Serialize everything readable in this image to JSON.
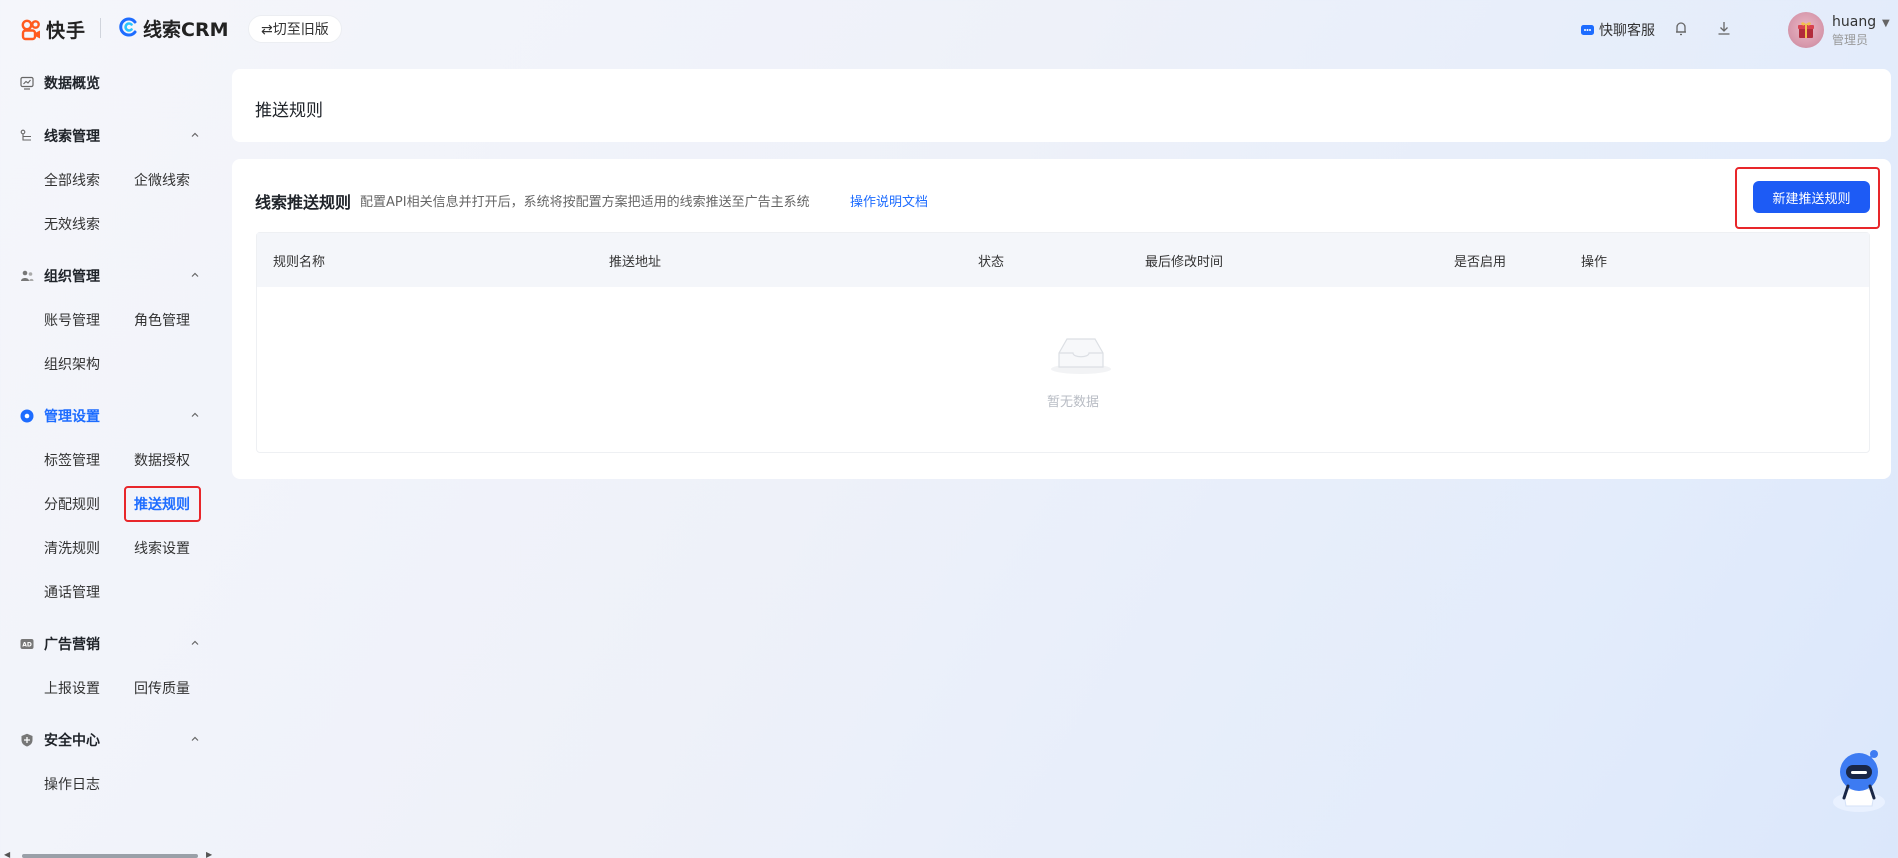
{
  "topbar": {
    "brand_name": "快手",
    "product_name": "线索CRM",
    "switch_label": "⇄切至旧版",
    "kefu_label": "快聊客服",
    "user_name": "huang",
    "user_role": "管理员"
  },
  "sidebar": {
    "data_overview": "数据概览",
    "groups": [
      {
        "label": "线索管理",
        "icon": "clue-icon",
        "items": [
          "全部线索",
          "企微线索",
          "无效线索"
        ]
      },
      {
        "label": "组织管理",
        "icon": "org-icon",
        "items": [
          "账号管理",
          "角色管理",
          "组织架构"
        ]
      },
      {
        "label": "管理设置",
        "icon": "settings-icon",
        "active": true,
        "items": [
          "标签管理",
          "数据授权",
          "分配规则",
          "推送规则",
          "清洗规则",
          "线索设置",
          "通话管理"
        ]
      },
      {
        "label": "广告营销",
        "icon": "ad-icon",
        "items": [
          "上报设置",
          "回传质量"
        ]
      },
      {
        "label": "安全中心",
        "icon": "shield-icon",
        "items": [
          "操作日志"
        ]
      }
    ],
    "active_item": "推送规则",
    "ad_badge": "AD"
  },
  "page": {
    "title": "推送规则",
    "section_title": "线索推送规则",
    "section_desc": "配置API相关信息并打开后，系统将按配置方案把适用的线索推送至广告主系统",
    "doc_link": "操作说明文档",
    "new_button": "新建推送规则"
  },
  "table": {
    "columns": [
      "规则名称",
      "推送地址",
      "状态",
      "最后修改时间",
      "是否启用",
      "操作"
    ],
    "rows": [],
    "empty_text": "暂无数据"
  },
  "colors": {
    "accent": "#1d6cff",
    "button": "#1d5bf5",
    "highlight_box": "#e8262a"
  }
}
